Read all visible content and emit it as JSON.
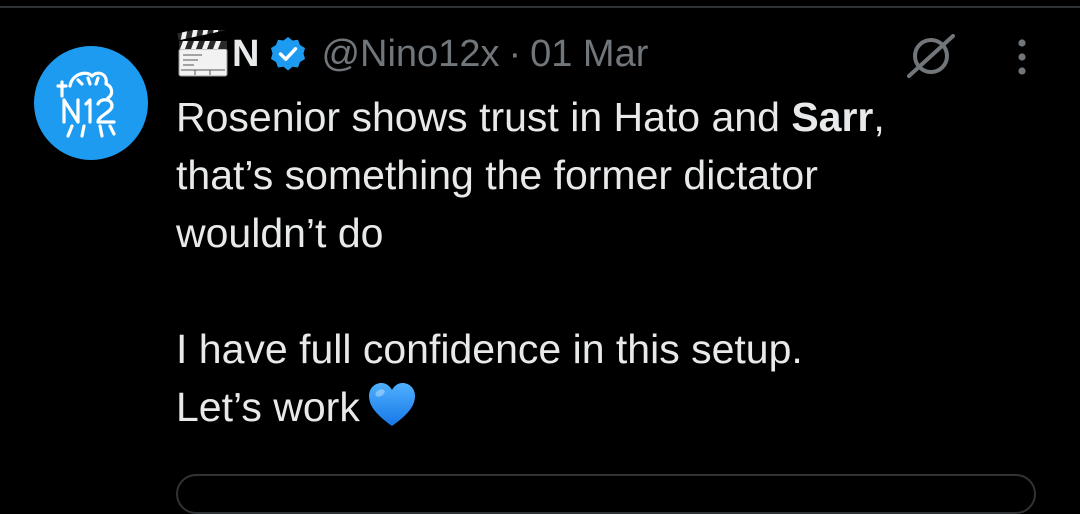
{
  "tweet": {
    "author": {
      "display_name": "N",
      "display_name_emoji": "clapper-board-icon",
      "handle": "@Nino12x",
      "verified": true,
      "avatar_text": "N12"
    },
    "separator": "·",
    "date": "01 Mar",
    "text": {
      "line1_prefix": "Rosenior shows trust in Hato and ",
      "line1_bold": "Sarr",
      "line1_suffix": ",",
      "line2": "that’s something the former dictator",
      "line3": "wouldn’t do",
      "line4": "I have full confidence in this setup.",
      "line5": "Let’s work",
      "emoji": "blue-heart-icon"
    },
    "colors": {
      "background": "#000000",
      "text": "#e7e9ea",
      "muted": "#71767b",
      "accent": "#1d9bf0",
      "heart": "#1d8cf0"
    }
  }
}
